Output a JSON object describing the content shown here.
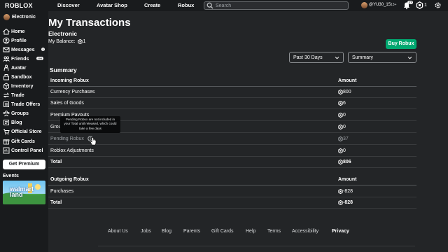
{
  "topbar": {
    "logo": "ROBLOX",
    "nav": [
      "Discover",
      "Avatar Shop",
      "Create",
      "Robux"
    ],
    "search_placeholder": "Search",
    "username": "@YU30_15",
    "age_label": "13+",
    "notifications_count": "17",
    "robux_balance": "1"
  },
  "sidebar": {
    "user": "Electronic",
    "items": [
      {
        "label": "Home",
        "icon": "home-icon"
      },
      {
        "label": "Profile",
        "icon": "profile-icon"
      },
      {
        "label": "Messages",
        "icon": "messages-icon",
        "badge": "1"
      },
      {
        "label": "Friends",
        "icon": "friends-icon",
        "badge": "200"
      },
      {
        "label": "Avatar",
        "icon": "avatar-icon"
      },
      {
        "label": "Sandbox",
        "icon": "sandbox-icon"
      },
      {
        "label": "Inventory",
        "icon": "inventory-icon"
      },
      {
        "label": "Trade",
        "icon": "trade-icon"
      },
      {
        "label": "Trade Offers",
        "icon": "trade-offers-icon"
      },
      {
        "label": "Groups",
        "icon": "groups-icon"
      },
      {
        "label": "Blog",
        "icon": "blog-icon"
      },
      {
        "label": "Official Store",
        "icon": "store-icon"
      },
      {
        "label": "Gift Cards",
        "icon": "gift-card-icon"
      },
      {
        "label": "Control Panel",
        "icon": "control-panel-icon"
      }
    ],
    "premium_button": "Get Premium",
    "events_label": "Events",
    "event_banner_text": "walmart land"
  },
  "main": {
    "title": "My Transactions",
    "context_name": "Electronic",
    "balance_label": "My Balance:",
    "balance_value": "1",
    "buy_robux": "Buy Robux",
    "period_dropdown": "Past 30 Days",
    "type_dropdown": "Summary",
    "section_title": "Summary",
    "incoming": {
      "header_label": "Incoming Robux",
      "header_amount": "Amount",
      "rows": [
        {
          "label": "Currency Purchases",
          "amount": "800"
        },
        {
          "label": "Sales of Goods",
          "amount": "6"
        },
        {
          "label": "Premium Payouts",
          "amount": "0"
        },
        {
          "label": "Group Payouts",
          "amount": "0"
        },
        {
          "label": "Pending Robux",
          "amount": "37"
        },
        {
          "label": "Roblox Adjustments",
          "amount": "0"
        }
      ],
      "total_label": "Total",
      "total_amount": "806"
    },
    "outgoing": {
      "header_label": "Outgoing Robux",
      "header_amount": "Amount",
      "rows": [
        {
          "label": "Purchases",
          "amount": "-828"
        }
      ],
      "total_label": "Total",
      "total_amount": "-828"
    },
    "tooltip": "Pending Robux are not included in your Total until released, which could take a few days"
  },
  "footer": {
    "links": [
      "About Us",
      "Jobs",
      "Blog",
      "Parents",
      "Gift Cards",
      "Help",
      "Terms",
      "Accessibility",
      "Privacy"
    ]
  },
  "colors": {
    "background": "#232527",
    "sidebar": "#191b1d",
    "buy_button": "#00a870",
    "muted_text": "#9a9ea2"
  }
}
